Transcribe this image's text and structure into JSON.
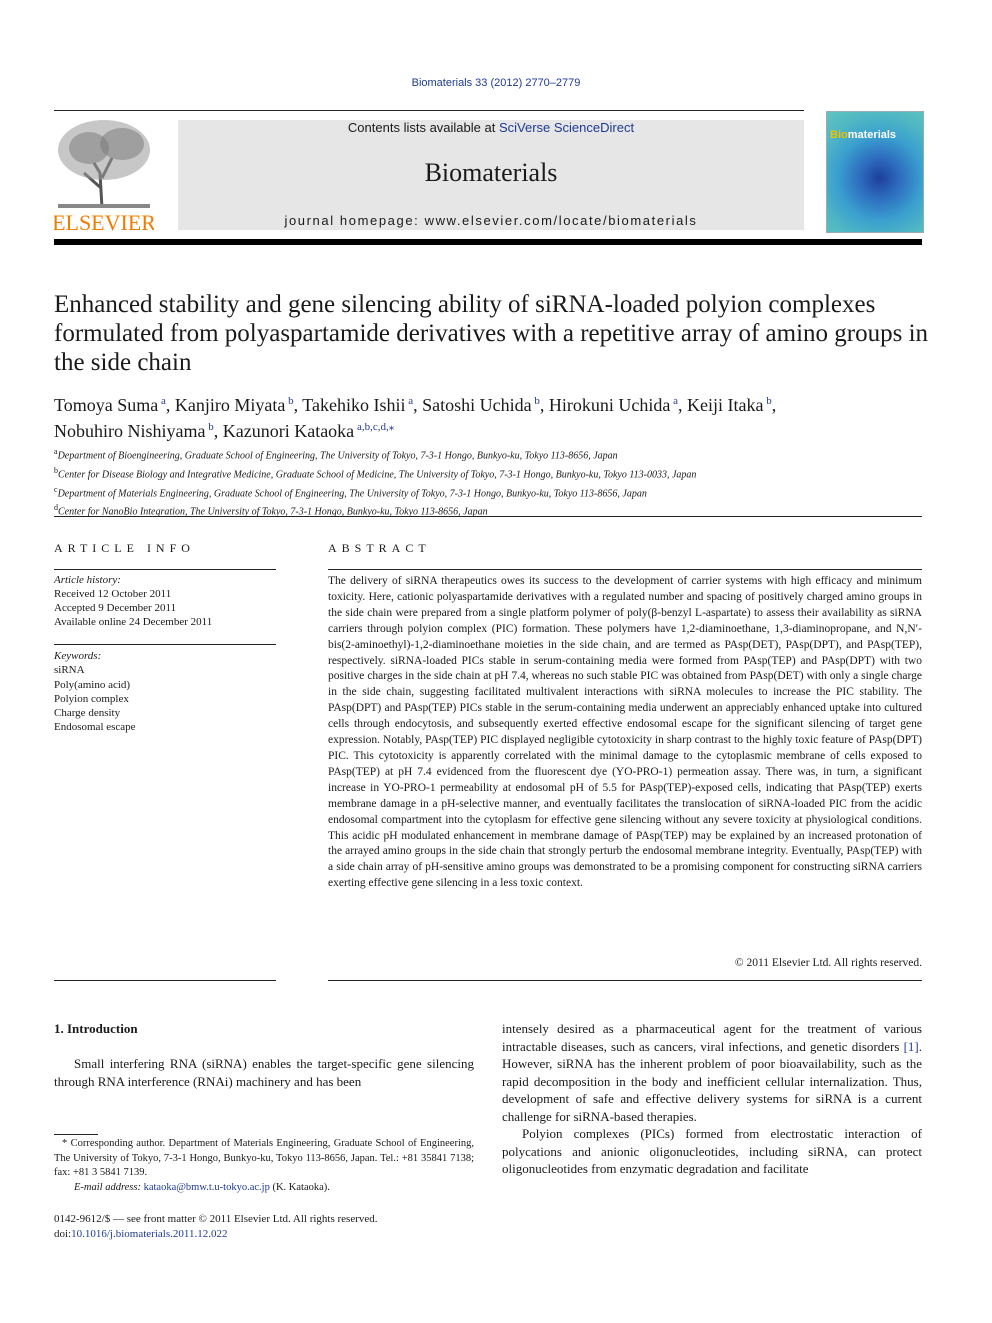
{
  "header": {
    "citation": "Biomaterials 33 (2012) 2770–2779",
    "contents_prefix": "Contents lists available at ",
    "contents_link": "SciVerse ScienceDirect",
    "journal_title": "Biomaterials",
    "homepage": "journal homepage: www.elsevier.com/locate/biomaterials",
    "publisher_logo": "ELSEVIER",
    "cover_title_bio": "Bio",
    "cover_title_rest": "materials"
  },
  "article": {
    "title": "Enhanced stability and gene silencing ability of siRNA-loaded polyion complexes formulated from polyaspartamide derivatives with a repetitive array of amino groups in the side chain",
    "authors": [
      {
        "name": "Tomoya Suma",
        "aff": "a",
        "sep": ", "
      },
      {
        "name": "Kanjiro Miyata",
        "aff": "b",
        "sep": ", "
      },
      {
        "name": "Takehiko Ishii",
        "aff": "a",
        "sep": ", "
      },
      {
        "name": "Satoshi Uchida",
        "aff": "b",
        "sep": ", "
      },
      {
        "name": "Hirokuni Uchida",
        "aff": "a",
        "sep": ", "
      },
      {
        "name": "Keiji Itaka",
        "aff": "b",
        "sep": ","
      },
      {
        "name": "Nobuhiro Nishiyama",
        "aff": "b",
        "sep": ", "
      },
      {
        "name": "Kazunori Kataoka",
        "aff": "a,b,c,d,⁎",
        "sep": ""
      }
    ],
    "affiliations": [
      {
        "key": "a",
        "text": "Department of Bioengineering, Graduate School of Engineering, The University of Tokyo, 7-3-1 Hongo, Bunkyo-ku, Tokyo 113-8656, Japan"
      },
      {
        "key": "b",
        "text": "Center for Disease Biology and Integrative Medicine, Graduate School of Medicine, The University of Tokyo, 7-3-1 Hongo, Bunkyo-ku, Tokyo 113-0033, Japan"
      },
      {
        "key": "c",
        "text": "Department of Materials Engineering, Graduate School of Engineering, The University of Tokyo, 7-3-1 Hongo, Bunkyo-ku, Tokyo 113-8656, Japan"
      },
      {
        "key": "d",
        "text": "Center for NanoBio Integration, The University of Tokyo, 7-3-1 Hongo, Bunkyo-ku, Tokyo 113-8656, Japan"
      }
    ]
  },
  "article_info": {
    "heading": "ARTICLE INFO",
    "history_label": "Article history:",
    "received": "Received 12 October 2011",
    "accepted": "Accepted 9 December 2011",
    "online": "Available online 24 December 2011",
    "keywords_label": "Keywords:",
    "keywords": [
      "siRNA",
      "Poly(amino acid)",
      "Polyion complex",
      "Charge density",
      "Endosomal escape"
    ]
  },
  "abstract": {
    "heading": "ABSTRACT",
    "text": "The delivery of siRNA therapeutics owes its success to the development of carrier systems with high efficacy and minimum toxicity. Here, cationic polyaspartamide derivatives with a regulated number and spacing of positively charged amino groups in the side chain were prepared from a single platform polymer of poly(β-benzyl L-aspartate) to assess their availability as siRNA carriers through polyion complex (PIC) formation. These polymers have 1,2-diaminoethane, 1,3-diaminopropane, and N,N′-bis(2-aminoethyl)-1,2-diaminoethane moieties in the side chain, and are termed as PAsp(DET), PAsp(DPT), and PAsp(TEP), respectively. siRNA-loaded PICs stable in serum-containing media were formed from PAsp(TEP) and PAsp(DPT) with two positive charges in the side chain at pH 7.4, whereas no such stable PIC was obtained from PAsp(DET) with only a single charge in the side chain, suggesting facilitated multivalent interactions with siRNA molecules to increase the PIC stability. The PAsp(DPT) and PAsp(TEP) PICs stable in the serum-containing media underwent an appreciably enhanced uptake into cultured cells through endocytosis, and subsequently exerted effective endosomal escape for the significant silencing of target gene expression. Notably, PAsp(TEP) PIC displayed negligible cytotoxicity in sharp contrast to the highly toxic feature of PAsp(DPT) PIC. This cytotoxicity is apparently correlated with the minimal damage to the cytoplasmic membrane of cells exposed to PAsp(TEP) at pH 7.4 evidenced from the fluorescent dye (YO-PRO-1) permeation assay. There was, in turn, a significant increase in YO-PRO-1 permeability at endosomal pH of 5.5 for PAsp(TEP)-exposed cells, indicating that PAsp(TEP) exerts membrane damage in a pH-selective manner, and eventually facilitates the translocation of siRNA-loaded PIC from the acidic endosomal compartment into the cytoplasm for effective gene silencing without any severe toxicity at physiological conditions. This acidic pH modulated enhancement in membrane damage of PAsp(TEP) may be explained by an increased protonation of the arrayed amino groups in the side chain that strongly perturb the endosomal membrane integrity. Eventually, PAsp(TEP) with a side chain array of pH-sensitive amino groups was demonstrated to be a promising component for constructing siRNA carriers exerting effective gene silencing in a less toxic context.",
    "copyright": "© 2011 Elsevier Ltd. All rights reserved."
  },
  "introduction": {
    "heading": "1.  Introduction",
    "left_text": "Small interfering RNA (siRNA) enables the target-specific gene silencing through RNA interference (RNAi) machinery and has been",
    "right_p1_a": "intensely desired as a pharmaceutical agent for the treatment of various intractable diseases, such as cancers, viral infections, and genetic disorders ",
    "right_p1_ref": "[1]",
    "right_p1_b": ". However, siRNA has the inherent problem of poor bioavailability, such as the rapid decomposition in the body and inefficient cellular internalization. Thus, development of safe and effective delivery systems for siRNA is a current challenge for siRNA-based therapies.",
    "right_p2": "Polyion complexes (PICs) formed from electrostatic interaction of polycations and anionic oligonucleotides, including siRNA, can protect oligonucleotides from enzymatic degradation and facilitate"
  },
  "footnote": {
    "corresponding": "* Corresponding author. Department of Materials Engineering, Graduate School of Engineering, The University of Tokyo, 7-3-1 Hongo, Bunkyo-ku, Tokyo 113-8656, Japan. Tel.: +81 35841 7138; fax: +81 3 5841 7139.",
    "email_label": "E-mail address: ",
    "email": "kataoka@bmw.t.u-tokyo.ac.jp",
    "email_suffix": " (K. Kataoka)."
  },
  "front_matter": {
    "issn": "0142-9612/$ — see front matter © 2011 Elsevier Ltd. All rights reserved.",
    "doi_label": "doi:",
    "doi": "10.1016/j.biomaterials.2011.12.022"
  }
}
